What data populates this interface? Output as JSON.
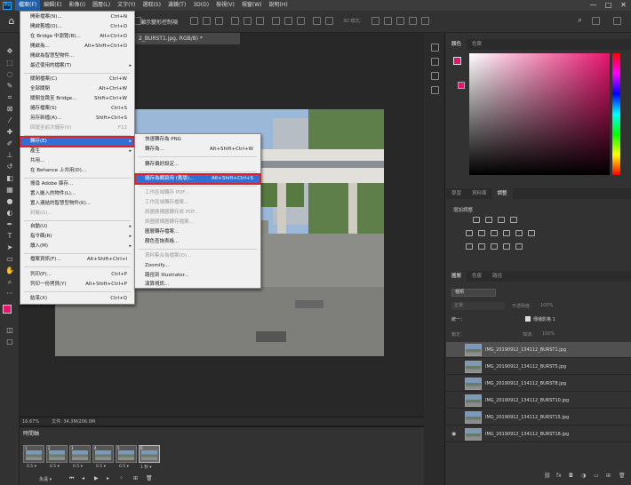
{
  "menubar": {
    "logo": "Ps",
    "items": [
      "檔案(F)",
      "編輯(E)",
      "影像(I)",
      "圖層(L)",
      "文字(Y)",
      "選取(S)",
      "濾鏡(T)",
      "3D(D)",
      "檢視(V)",
      "視窗(W)",
      "說明(H)"
    ],
    "window_controls": [
      "—",
      "□",
      "✕"
    ]
  },
  "options_bar": {
    "label": "顯示變形控制項",
    "mode_3d": "3D 模式："
  },
  "document_tab": "2_BURST1.jpg, RGB/8) *",
  "status_bar": {
    "zoom": "16.67%",
    "doc_size": "文件: 34.3M/206.0M"
  },
  "timeline": {
    "title": "時間軸",
    "frames": [
      {
        "num": "1",
        "delay": "0.5 ▾"
      },
      {
        "num": "2",
        "delay": "0.5 ▾"
      },
      {
        "num": "3",
        "delay": "0.5 ▾"
      },
      {
        "num": "4",
        "delay": "0.5 ▾"
      },
      {
        "num": "5",
        "delay": "0.5 ▾"
      },
      {
        "num": "6",
        "delay": "1 秒 ▾"
      }
    ],
    "loop": "永遠 ▾"
  },
  "file_menu": {
    "items": [
      {
        "label": "開新檔案(N)...",
        "shortcut": "Ctrl+N"
      },
      {
        "label": "開啟舊檔(O)...",
        "shortcut": "Ctrl+O"
      },
      {
        "label": "在 Bridge 中瀏覽(B)...",
        "shortcut": "Alt+Ctrl+O"
      },
      {
        "label": "開啟為...",
        "shortcut": "Alt+Shift+Ctrl+O"
      },
      {
        "label": "開啟為智慧型物件...",
        "shortcut": ""
      },
      {
        "label": "最近使用的檔案(T)",
        "shortcut": ""
      },
      {
        "label": "關閉檔案(C)",
        "shortcut": "Ctrl+W"
      },
      {
        "label": "全部關閉",
        "shortcut": "Alt+Ctrl+W"
      },
      {
        "label": "關閉並跳至 Bridge...",
        "shortcut": "Shift+Ctrl+W"
      },
      {
        "label": "儲存檔案(S)",
        "shortcut": "Ctrl+S"
      },
      {
        "label": "另存新檔(A)...",
        "shortcut": "Shift+Ctrl+S"
      },
      {
        "label": "回復至前次儲存(V)",
        "shortcut": "F12"
      },
      {
        "label": "轉存(E)",
        "shortcut": ""
      },
      {
        "label": "產生",
        "shortcut": ""
      },
      {
        "label": "共用...",
        "shortcut": ""
      },
      {
        "label": "在 Behance 上共用(D)...",
        "shortcut": ""
      },
      {
        "label": "搜尋 Adobe 庫存...",
        "shortcut": ""
      },
      {
        "label": "置入嵌入的物件(L)...",
        "shortcut": ""
      },
      {
        "label": "置入連結的智慧型物件(K)...",
        "shortcut": ""
      },
      {
        "label": "封裝(G)...",
        "shortcut": ""
      },
      {
        "label": "自動(U)",
        "shortcut": ""
      },
      {
        "label": "指令碼(R)",
        "shortcut": ""
      },
      {
        "label": "讀入(M)",
        "shortcut": ""
      },
      {
        "label": "檔案資訊(F)...",
        "shortcut": "Alt+Shift+Ctrl+I"
      },
      {
        "label": "列印(P)...",
        "shortcut": "Ctrl+P"
      },
      {
        "label": "列印一份拷貝(Y)",
        "shortcut": "Alt+Shift+Ctrl+P"
      },
      {
        "label": "結束(X)",
        "shortcut": "Ctrl+Q"
      }
    ]
  },
  "export_menu": {
    "items": [
      {
        "label": "快速轉存為 PNG",
        "shortcut": ""
      },
      {
        "label": "轉存為...",
        "shortcut": "Alt+Shift+Ctrl+W"
      },
      {
        "label": "轉存偏好設定...",
        "shortcut": ""
      },
      {
        "label": "儲存為網頁用 (舊版)...",
        "shortcut": "Alt+Shift+Ctrl+S"
      },
      {
        "label": "工作區域轉存 PDF...",
        "shortcut": ""
      },
      {
        "label": "工作區域轉存檔案...",
        "shortcut": ""
      },
      {
        "label": "將圖層構圖轉存成 PDF...",
        "shortcut": ""
      },
      {
        "label": "將圖層構圖轉存檔案...",
        "shortcut": ""
      },
      {
        "label": "圖層轉存檔案...",
        "shortcut": ""
      },
      {
        "label": "顏色查詢表格...",
        "shortcut": ""
      },
      {
        "label": "資料集合為檔案(D)...",
        "shortcut": ""
      },
      {
        "label": "Zoomify...",
        "shortcut": ""
      },
      {
        "label": "路徑到 Illustrator...",
        "shortcut": ""
      },
      {
        "label": "演算視訊...",
        "shortcut": ""
      }
    ]
  },
  "color_panel": {
    "tabs": [
      "顏色",
      "色票"
    ],
    "fg_color": "#e8146f"
  },
  "adjust_panel": {
    "tabs": [
      "學習",
      "資料庫",
      "調整"
    ],
    "title": "增加調整"
  },
  "layers_panel": {
    "tabs": [
      "圖層",
      "色版",
      "路徑"
    ],
    "kind": "種類",
    "blend": "正常",
    "opacity_label": "不透明度：",
    "opacity": "100%",
    "unify_label": "統一：",
    "propagate": "傳播影格 1",
    "lock_label": "鎖定：",
    "fill_label": "填滿：",
    "fill": "100%",
    "layers": [
      "IMG_20190912_134112_BURST1.jpg",
      "IMG_20190912_134112_BURST5.jpg",
      "IMG_20190912_134112_BURST8.jpg",
      "IMG_20190912_134112_BURST10.jpg",
      "IMG_20190912_134112_BURST15.jpg",
      "IMG_20190912_134112_BURST18.jpg"
    ]
  }
}
